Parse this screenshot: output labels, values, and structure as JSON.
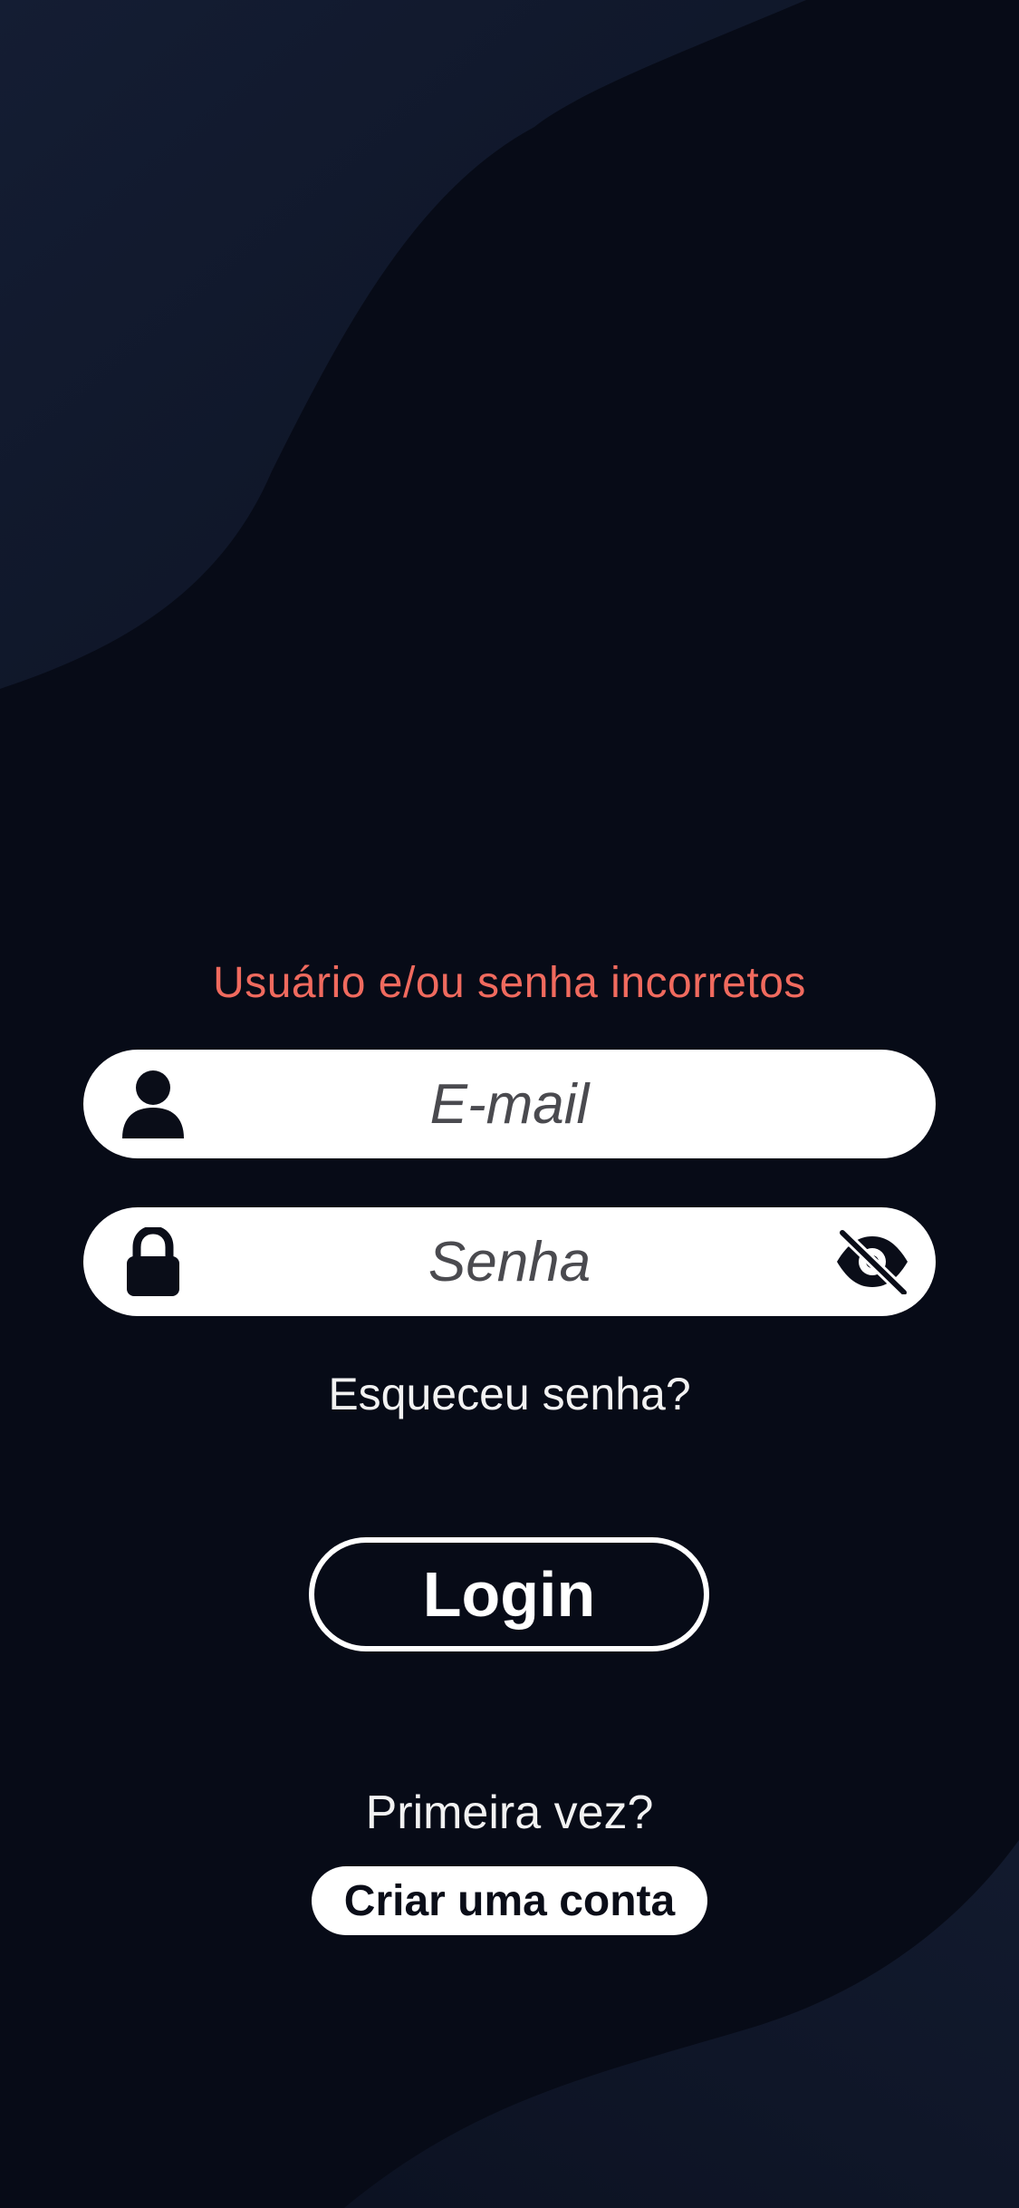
{
  "colors": {
    "background": "#070b17",
    "wave": "#121a2e",
    "error": "#f06a5e",
    "field_background": "#ffffff",
    "text_light": "#f2f2f2"
  },
  "login_form": {
    "error_message": "Usuário e/ou senha incorretos",
    "email": {
      "icon": "user-icon",
      "placeholder": "E-mail",
      "value": ""
    },
    "password": {
      "icon": "lock-icon",
      "placeholder": "Senha",
      "value": "",
      "toggle_icon": "eye-off-icon"
    },
    "forgot_password_label": "Esqueceu senha?",
    "login_button_label": "Login"
  },
  "signup": {
    "prompt": "Primeira vez?",
    "create_account_label": "Criar uma conta"
  }
}
